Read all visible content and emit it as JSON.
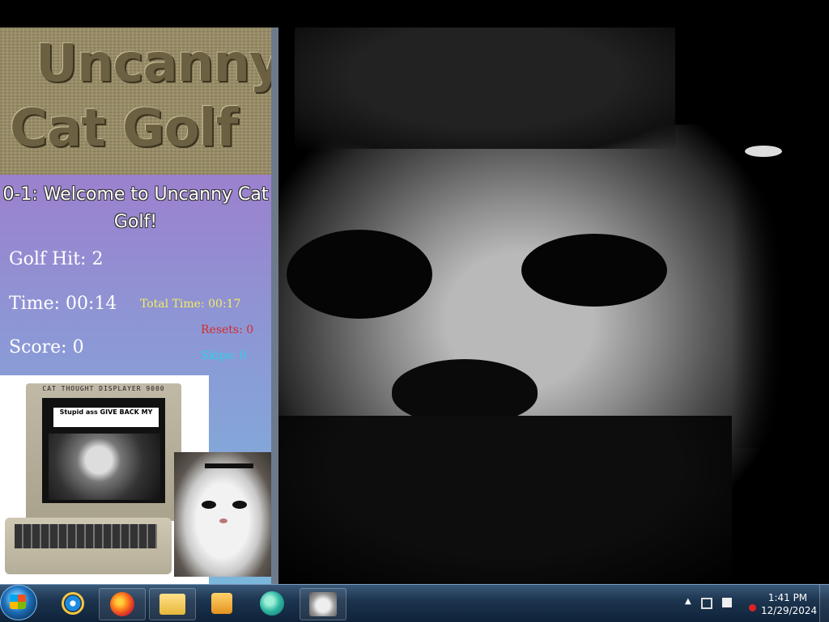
{
  "game": {
    "logo_line1": "Uncanny",
    "logo_line2": "Cat Golf",
    "level_title": "0-1: Welcome to Uncanny Cat Golf!",
    "golf_hit": "Golf Hit: 2",
    "time": "Time: 00:14",
    "total_time": "Total Time: 00:17",
    "resets": "Resets: 0",
    "score": "Score: 0",
    "skips": "Skips: 0",
    "monitor_label": "CAT THOUGHT DISPLAYER 9000",
    "speech": "Stupid ass GIVE BACK MY"
  },
  "colors": {
    "sidebar_top": "#9b7ad1",
    "sidebar_bottom": "#7bb6db",
    "total_time": "#f2ee62",
    "resets": "#d62a2a",
    "skips": "#2fd0e8"
  },
  "taskbar": {
    "icons": [
      "start-orb-icon",
      "internet-explorer-icon",
      "firefox-icon",
      "file-explorer-icon",
      "media-player-icon",
      "app-icon",
      "cat-game-icon"
    ],
    "clock_time": "1:41 PM",
    "clock_date": "12/29/2024",
    "tray_icons": [
      "show-hidden-arrow-icon",
      "network-icon",
      "action-center-flag-icon",
      "volume-muted-icon"
    ]
  }
}
